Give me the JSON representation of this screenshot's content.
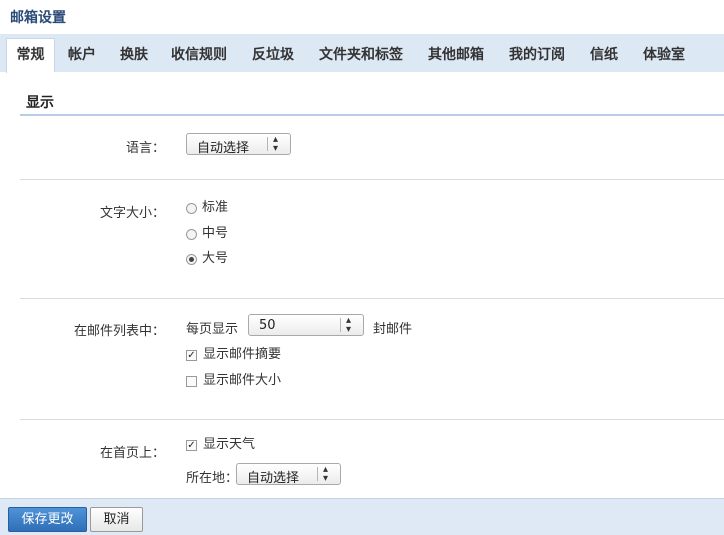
{
  "page_title": "邮箱设置",
  "tabs": [
    {
      "label": "常规",
      "active": true
    },
    {
      "label": "帐户"
    },
    {
      "label": "换肤"
    },
    {
      "label": "收信规则"
    },
    {
      "label": "反垃圾"
    },
    {
      "label": "文件夹和标签"
    },
    {
      "label": "其他邮箱"
    },
    {
      "label": "我的订阅"
    },
    {
      "label": "信纸"
    },
    {
      "label": "体验室"
    }
  ],
  "section": {
    "title": "显示"
  },
  "language": {
    "label": "语言：",
    "value": "自动选择"
  },
  "font_size": {
    "label": "文字大小：",
    "options": [
      "标准",
      "中号",
      "大号"
    ],
    "selected": "大号"
  },
  "mail_list": {
    "label": "在邮件列表中：",
    "per_page_prefix": "每页显示",
    "per_page_value": "50",
    "per_page_suffix": "封邮件",
    "show_summary": {
      "label": "显示邮件摘要",
      "checked": true
    },
    "show_size": {
      "label": "显示邮件大小",
      "checked": false
    }
  },
  "homepage": {
    "label": "在首页上：",
    "show_weather": {
      "label": "显示天气",
      "checked": true
    },
    "location_label": "所在地：",
    "location_value": "自动选择"
  },
  "footer": {
    "save_label": "保存更改",
    "cancel_label": "取消"
  }
}
